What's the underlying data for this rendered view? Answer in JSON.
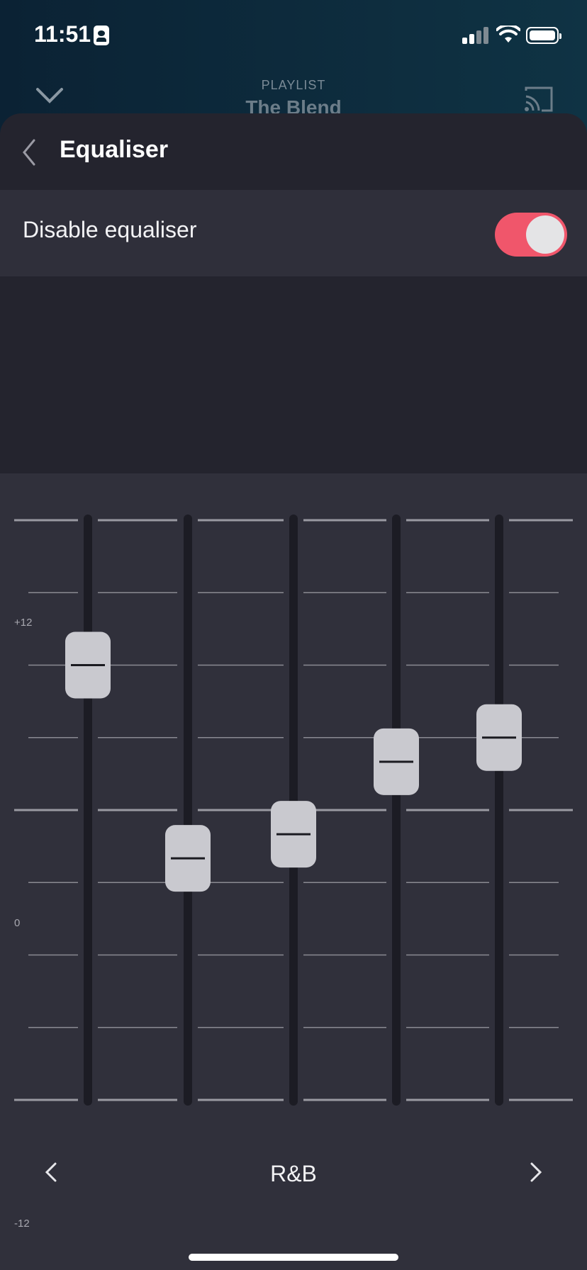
{
  "status_bar": {
    "time": "11:51"
  },
  "background": {
    "subtitle": "PLAYLIST",
    "title": "The Blend"
  },
  "sheet": {
    "title": "Equaliser",
    "toggle_label": "Disable equaliser",
    "toggle_on": true
  },
  "equalizer": {
    "scale_top": "+12",
    "scale_mid": "0",
    "scale_bottom": "-12",
    "bands_db": [
      6,
      -2,
      -1,
      2,
      3
    ]
  },
  "preset": {
    "name": "R&B"
  },
  "colors": {
    "accent": "#f0566b",
    "knob": "#c9c9cf",
    "track": "#1c1c24"
  }
}
